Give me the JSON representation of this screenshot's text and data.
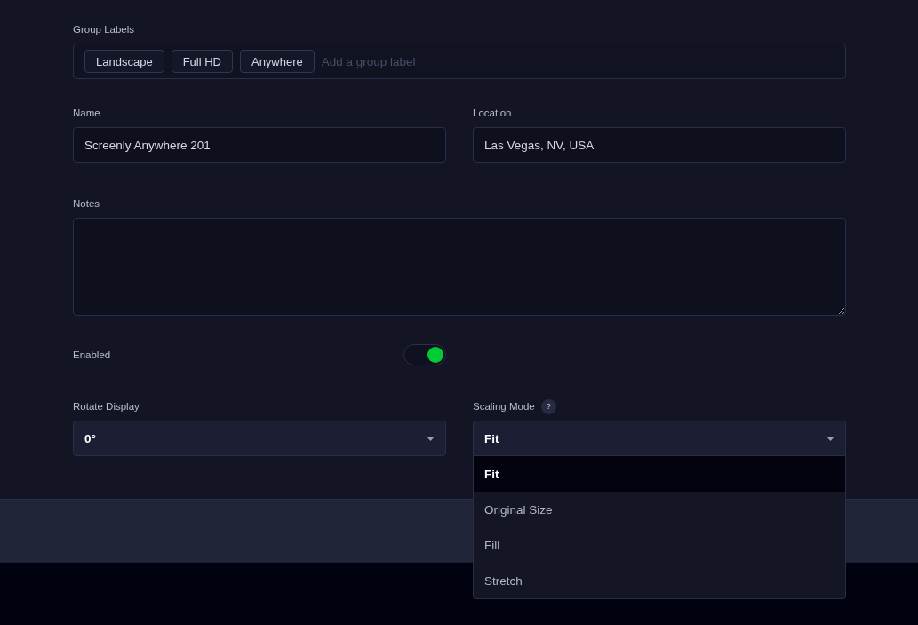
{
  "group_labels": {
    "label": "Group Labels",
    "tags": [
      "Landscape",
      "Full HD",
      "Anywhere"
    ],
    "placeholder": "Add a group label"
  },
  "name": {
    "label": "Name",
    "value": "Screenly Anywhere 201"
  },
  "location": {
    "label": "Location",
    "value": "Las Vegas, NV, USA"
  },
  "notes": {
    "label": "Notes"
  },
  "enabled": {
    "label": "Enabled",
    "on": true
  },
  "rotate_display": {
    "label": "Rotate Display",
    "value": "0°"
  },
  "scaling_mode": {
    "label": "Scaling Mode",
    "help": "?",
    "value": "Fit",
    "expanded": true,
    "options": [
      {
        "label": "Fit",
        "selected": true
      },
      {
        "label": "Original Size",
        "selected": false
      },
      {
        "label": "Fill",
        "selected": false
      },
      {
        "label": "Stretch",
        "selected": false
      }
    ]
  }
}
